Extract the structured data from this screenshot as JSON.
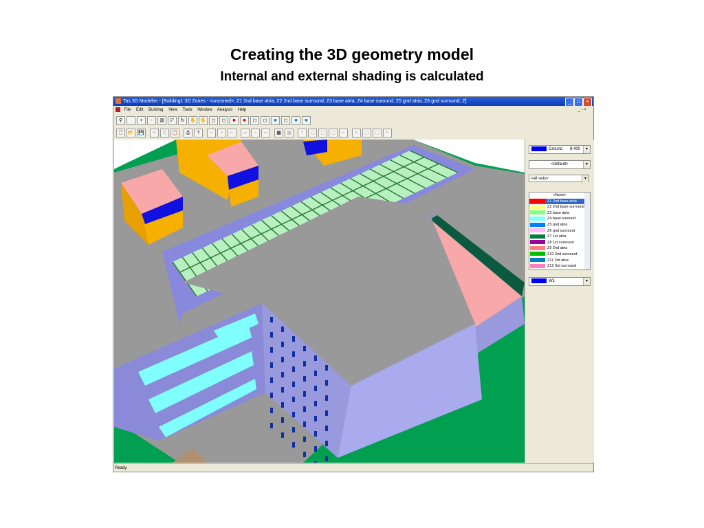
{
  "slide": {
    "title": "Creating the 3D geometry model",
    "subtitle": "Internal and external shading is calculated"
  },
  "window": {
    "title": "Tas 3D Modeller - [Building1  3D Zones -  <unzoned>, Z1 2nd base atria, Z2 2nd base surround, Z3 base atria, Z4 base suround, Z5 gnd atria, Z6 gnd surround, Z]",
    "menu": [
      "File",
      "Edit",
      "Building",
      "View",
      "Tools",
      "Window",
      "Analysis",
      "Help"
    ]
  },
  "panel": {
    "ground": {
      "label": "Ground",
      "value": "8.400",
      "color": "#0000ee"
    },
    "view_set": "<default>",
    "sets": "<all sets>",
    "zones": [
      {
        "label": "<None>",
        "color": ""
      },
      {
        "label": "Z1 2nd base atria",
        "color": "#ff0000",
        "selected": true
      },
      {
        "label": "Z2 2nd base surround",
        "color": "#ffff80"
      },
      {
        "label": "Z3 base atria",
        "color": "#80ff80"
      },
      {
        "label": "Z4 base suround",
        "color": "#80ffff"
      },
      {
        "label": "Z5 gnd atria",
        "color": "#0080ff"
      },
      {
        "label": "Z6 gnd surround",
        "color": "#ffc0ff"
      },
      {
        "label": "Z7 1st atria",
        "color": "#008040"
      },
      {
        "label": "Z8 1st surround",
        "color": "#a000a0"
      },
      {
        "label": "Z9 2nd atria",
        "color": "#ff8080"
      },
      {
        "label": "Z10 2nd surround",
        "color": "#00c000"
      },
      {
        "label": "Z11 3rd atria",
        "color": "#0080c0"
      },
      {
        "label": "Z12 3rd surround",
        "color": "#ff80c0"
      }
    ],
    "window_type": {
      "label": "W1",
      "color": "#0000ee"
    }
  },
  "status": "Ready"
}
